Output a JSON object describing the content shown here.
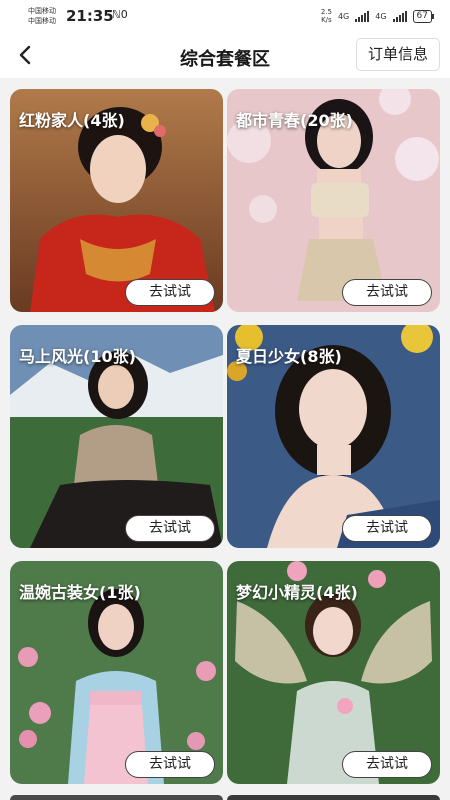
{
  "status_bar": {
    "carrier_1": "中国移动",
    "carrier_2": "中国移动",
    "time": "21:35",
    "extra_glyph": "ℕ0",
    "speed_value": "2.5",
    "speed_unit": "K/s",
    "network_1": "4G",
    "network_2": "4G",
    "battery": "67"
  },
  "header": {
    "title": "综合套餐区",
    "orders_button": "订单信息",
    "back_icon": "chevron-left-icon"
  },
  "packages": [
    {
      "title": "红粉家人(4张)",
      "button": "去试试"
    },
    {
      "title": "都市青春(20张)",
      "button": "去试试"
    },
    {
      "title": "马上风光(10张)",
      "button": "去试试"
    },
    {
      "title": "夏日少女(8张)",
      "button": "去试试"
    },
    {
      "title": "温婉古装女(1张)",
      "button": "去试试"
    },
    {
      "title": "梦幻小精灵(4张)",
      "button": "去试试"
    }
  ],
  "colors": {
    "background": "#f2f2f2",
    "header_bg": "#ffffff",
    "label_text": "#ffffff",
    "button_bg": "#ffffff"
  }
}
